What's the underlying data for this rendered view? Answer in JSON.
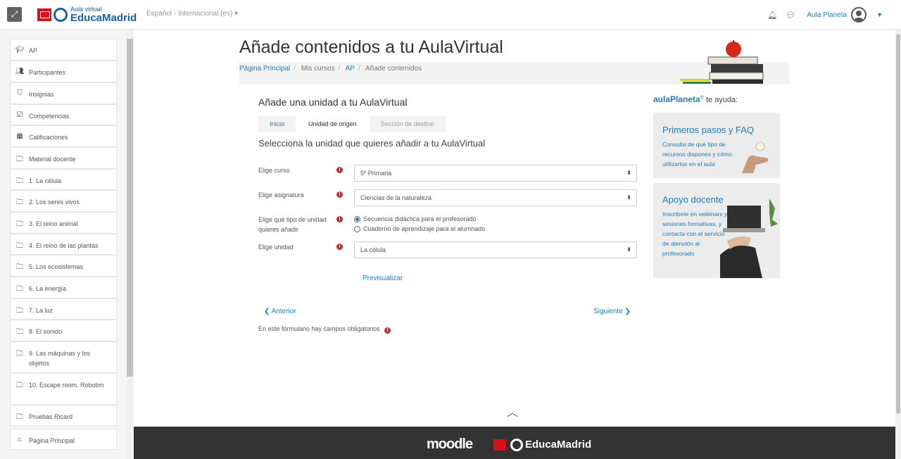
{
  "navbar": {
    "brand_sub": "Aula virtual",
    "brand_main": "EducaMadrid",
    "language": "Español - Internacional (es)",
    "user_name": "Aula Planeta"
  },
  "sidebar": {
    "items": [
      {
        "label": "AP",
        "icon": "graduation-cap-icon"
      },
      {
        "label": "Participantes",
        "icon": "users-icon"
      },
      {
        "label": "Insignias",
        "icon": "shield-icon"
      },
      {
        "label": "Competencias",
        "icon": "checkbox-icon"
      },
      {
        "label": "Calificaciones",
        "icon": "table-icon"
      },
      {
        "label": "Material docente",
        "icon": "folder-icon"
      },
      {
        "label": "1. La célula",
        "icon": "folder-icon"
      },
      {
        "label": "2. Los seres vivos",
        "icon": "folder-icon"
      },
      {
        "label": "3. El reino animal",
        "icon": "folder-icon"
      },
      {
        "label": "4. El reino de las plantas",
        "icon": "folder-icon"
      },
      {
        "label": "5. Los ecosistemas",
        "icon": "folder-icon"
      },
      {
        "label": "6. La energía",
        "icon": "folder-icon"
      },
      {
        "label": "7. La luz",
        "icon": "folder-icon"
      },
      {
        "label": "8. El sonido",
        "icon": "folder-icon"
      },
      {
        "label": "9. Las máquinas y los objetos",
        "icon": "folder-icon"
      },
      {
        "label": "10. Escape room. Robotim",
        "icon": "folder-icon"
      },
      {
        "label": "Pruebas Ricard",
        "icon": "folder-icon"
      },
      {
        "label": "Página Principal",
        "icon": "home-icon"
      }
    ]
  },
  "page": {
    "title": "Añade contenidos a tu AulaVirtual",
    "breadcrumb": [
      "Página Principal",
      "Mis cursos",
      "AP",
      "Añade contenidos"
    ]
  },
  "wizard": {
    "subtitle": "Añade una unidad a tu AulaVirtual",
    "steps": [
      "Inicio",
      "Unidad de origen",
      "Sección de destino"
    ],
    "heading": "Selecciona la unidad que quieres añadir a tu AulaVirtual",
    "fields": {
      "course_label": "Elige curso",
      "course_value": "5º Primaria",
      "subject_label": "Elige asignatura",
      "subject_value": "Ciencias de la naturaleza",
      "type_label": "Elige qué tipo de unidad quieres añadir",
      "type_options": [
        "Secuencia didáctica para el profesorado",
        "Cuaderno de aprendizaje para el alumnado"
      ],
      "type_selected": "Secuencia didáctica para el profesorado",
      "unit_label": "Elige unidad",
      "unit_value": "La célula"
    },
    "preview": "Previsualizar",
    "prev": "Anterior",
    "next": "Siguiente",
    "required_note": "En este formulario hay campos obligatorios"
  },
  "help": {
    "brand": "aulaPlaneta",
    "suffix": "te ayuda:",
    "cards": [
      {
        "title": "Primeros pasos y FAQ",
        "text": "Consulta de qué tipo de recursos dispones y cómo utilizarlos en el aula"
      },
      {
        "title": "Apoyo docente",
        "text": "Inscríbete en webinars y sesiones formativas, y contacta con el servicio de atención al profesorado"
      }
    ]
  },
  "footer": {
    "moodle": "moodle",
    "educamadrid": "EducaMadrid"
  },
  "colors": {
    "accent": "#1f7cb8",
    "brand": "#1b5ea8",
    "required": "#c82d2d",
    "footer": "#333333"
  }
}
